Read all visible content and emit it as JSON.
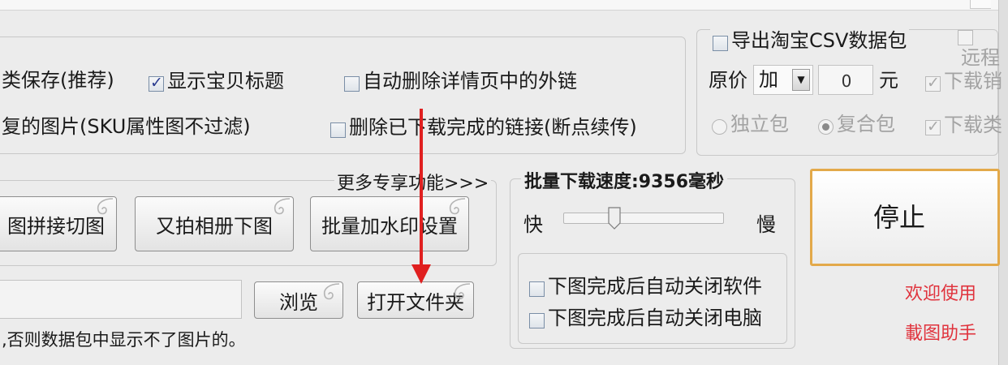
{
  "options": {
    "category_save": "类保存(推荐)",
    "show_title": "显示宝贝标题",
    "auto_delete_links": "自动删除详情页中的外链",
    "dup_images": "复的图片(SKU属性图不过滤)",
    "delete_downloaded": "删除已下载完成的链接(断点续传)"
  },
  "export_panel": {
    "export_csv": "导出淘宝CSV数据包",
    "remote_label": "远程",
    "original_price_label": "原价",
    "price_op": "加",
    "price_value": "0",
    "price_unit": "元",
    "download_sales": "下载销",
    "download_category": "下载类",
    "standalone_pkg": "独立包",
    "composite_pkg": "复合包"
  },
  "tools": {
    "more_features": "更多专享功能>>>",
    "stitch_cut_button": "图拼接切图",
    "youpai_album_button": "又拍相册下图",
    "watermark_button": "批量加水印设置"
  },
  "path": {
    "browse_button": "浏览",
    "open_folder_button": "打开文件夹",
    "hint_text": ",否则数据包中显示不了图片的。"
  },
  "speed": {
    "title": "批量下载速度:9356毫秒",
    "fast_label": "快",
    "slow_label": "慢",
    "level": 0.32,
    "auto_close_software": "下图完成后自动关闭软件",
    "auto_close_computer": "下图完成后自动关闭电脑"
  },
  "main": {
    "stop_button": "停止",
    "welcome_line1": "欢迎使用",
    "welcome_line2": "載图助手"
  },
  "colors": {
    "arrow": "#e02020",
    "accent_border": "#e3a94a",
    "welcome_text": "#e0333d"
  },
  "icons": {
    "button_decoration": "swirl-ornament-icon",
    "checkbox": "checkbox-icon",
    "dropdown": "chevron-down-icon",
    "annotation": "red-arrow-icon"
  }
}
